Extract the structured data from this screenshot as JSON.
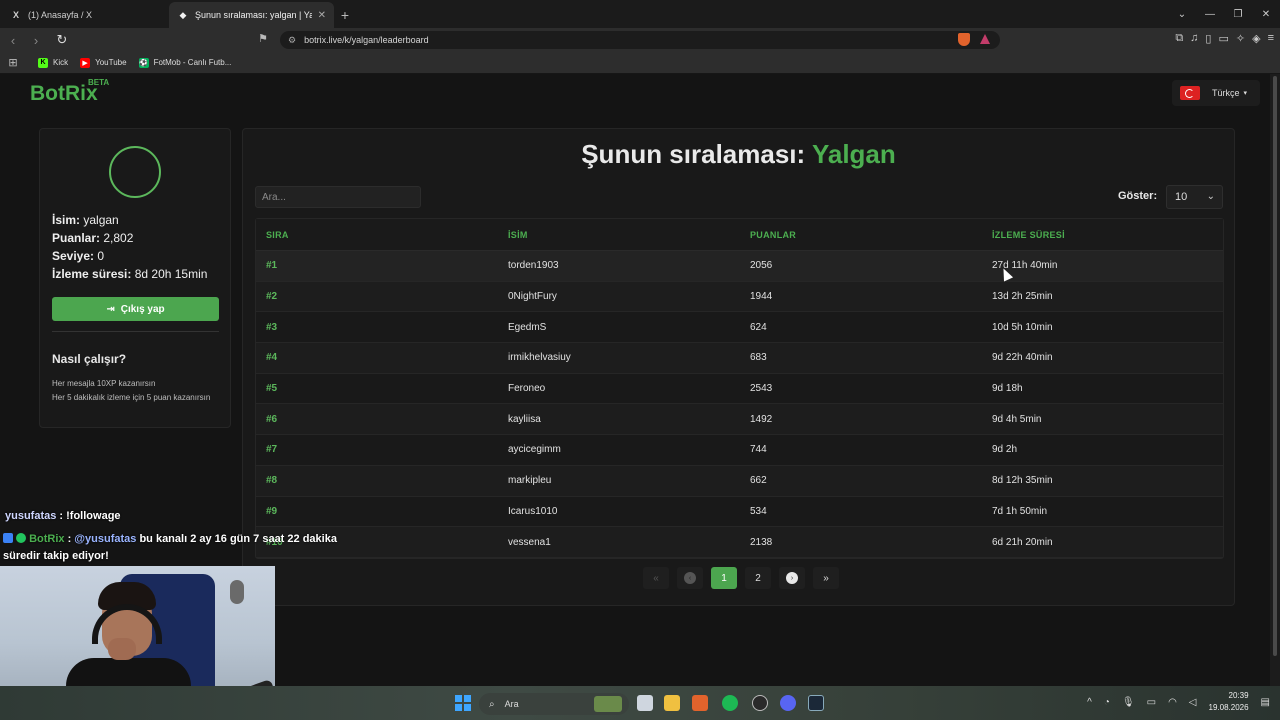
{
  "browser": {
    "tabs": [
      {
        "icon": "X",
        "title": "(1) Anasayfa / X",
        "active": false
      },
      {
        "icon": "◆",
        "title": "Şunun sıralaması: yalgan | Yayını",
        "active": true
      }
    ],
    "url": "botrix.live/k/yalgan/leaderboard",
    "bookmarks": [
      {
        "label": "Kick",
        "icon": "K",
        "color": "#53fc18"
      },
      {
        "label": "YouTube",
        "icon": "▶",
        "color": "#ff0000"
      },
      {
        "label": "FotMob - Canlı Futb...",
        "icon": "⚽",
        "color": "#00b35c"
      }
    ]
  },
  "header": {
    "logo": "BotRix",
    "logo_badge": "BETA",
    "language": "Türkçe"
  },
  "profile": {
    "name_label": "İsim:",
    "name_value": "yalgan",
    "points_label": "Puanlar:",
    "points_value": "2,802",
    "level_label": "Seviye:",
    "level_value": "0",
    "watch_label": "İzleme süresi:",
    "watch_value": "8d 20h 15min",
    "logout_label": "Çıkış yap",
    "how_title": "Nasıl çalışır?",
    "how_lines": [
      "Her mesajla 10XP kazanırsın",
      "Her 5 dakikalık izleme için 5 puan kazanırsın"
    ]
  },
  "leaderboard": {
    "title_prefix": "Şunun sıralaması:",
    "title_user": "Yalgan",
    "search_placeholder": "Ara...",
    "show_label": "Göster:",
    "show_value": "10",
    "columns": [
      "SIRA",
      "İSİM",
      "PUANLAR",
      "İZLEME SÜRESİ"
    ],
    "rows": [
      {
        "rank": "#1",
        "name": "torden1903",
        "points": "2056",
        "time": "27d 11h 40min"
      },
      {
        "rank": "#2",
        "name": "0NightFury",
        "points": "1944",
        "time": "13d 2h 25min"
      },
      {
        "rank": "#3",
        "name": "EgedmS",
        "points": "624",
        "time": "10d 5h 10min"
      },
      {
        "rank": "#4",
        "name": "irmikhelvasiuy",
        "points": "683",
        "time": "9d 22h 40min"
      },
      {
        "rank": "#5",
        "name": "Feroneo",
        "points": "2543",
        "time": "9d 18h"
      },
      {
        "rank": "#6",
        "name": "kayliisa",
        "points": "1492",
        "time": "9d 4h 5min"
      },
      {
        "rank": "#7",
        "name": "aycicegimm",
        "points": "744",
        "time": "9d 2h"
      },
      {
        "rank": "#8",
        "name": "markipleu",
        "points": "662",
        "time": "8d 12h 35min"
      },
      {
        "rank": "#9",
        "name": "Icarus1010",
        "points": "534",
        "time": "7d 1h 50min"
      },
      {
        "rank": "#10",
        "name": "vessena1",
        "points": "2138",
        "time": "6d 21h 20min"
      }
    ],
    "pagination": {
      "pages": [
        "1",
        "2"
      ],
      "current": "1"
    }
  },
  "chat": {
    "line1_user": "yusufatas",
    "line1_text": ": !followage",
    "line2_user": "BotRix",
    "line2_mention": "@yusufatas",
    "line2_text": "bu kanalı 2 ay 16 gün 7 saat 22 dakika süredir takip ediyor!"
  },
  "taskbar": {
    "search_label": "Ara",
    "time": "20:39",
    "date": "19.08.2026"
  }
}
